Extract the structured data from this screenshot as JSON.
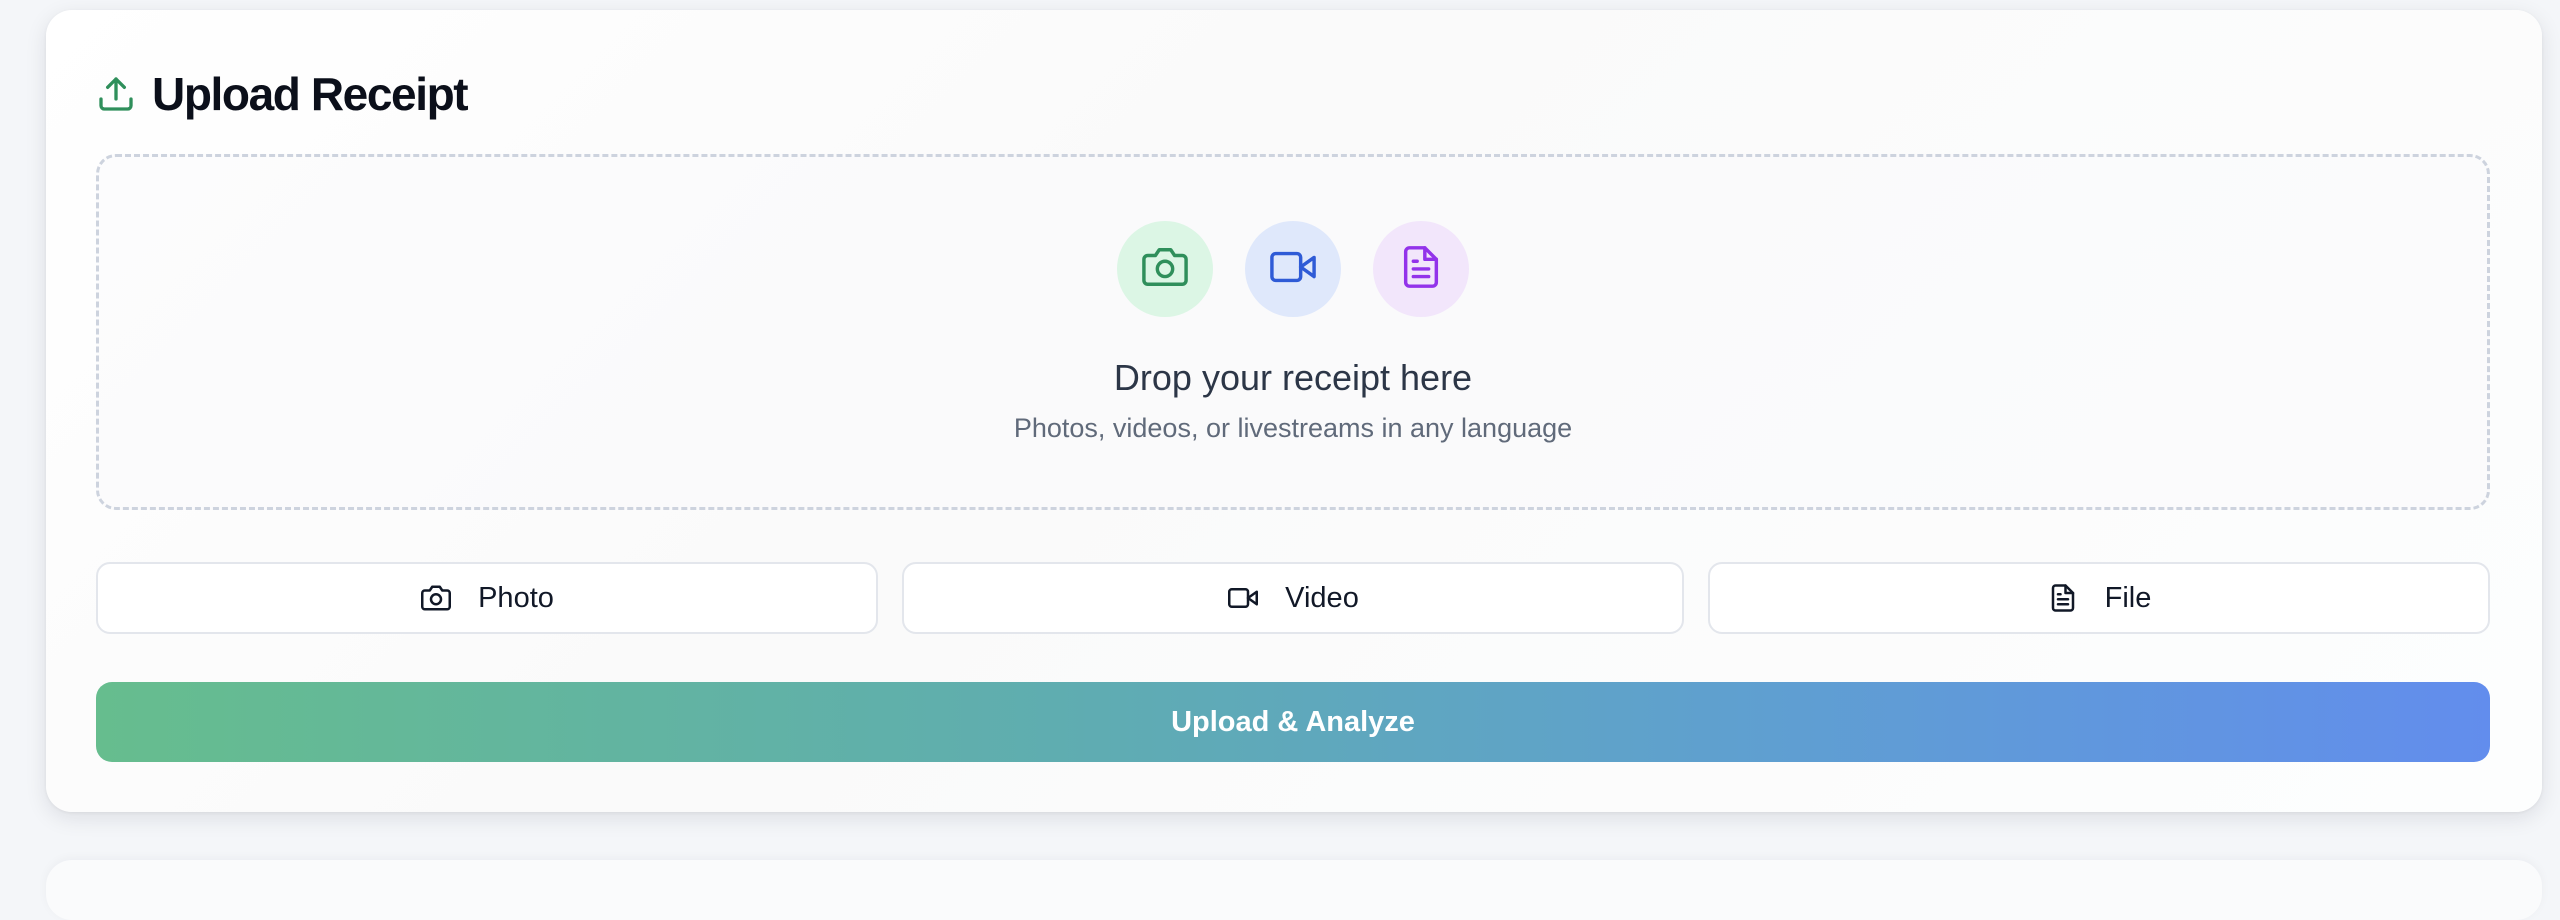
{
  "header": {
    "title": "Upload Receipt",
    "icon": "upload-icon",
    "icon_color": "#2f8f5b"
  },
  "dropzone": {
    "icons": [
      {
        "name": "camera-icon",
        "color": "#2f8f5b",
        "bg": "#dcf6e5"
      },
      {
        "name": "video-icon",
        "color": "#2f5bd6",
        "bg": "#dfe8fb"
      },
      {
        "name": "document-icon",
        "color": "#9333ea",
        "bg": "#f2e6fb"
      }
    ],
    "title": "Drop your receipt here",
    "subtitle": "Photos, videos, or livestreams in any language"
  },
  "options": [
    {
      "label": "Photo",
      "icon": "camera-icon"
    },
    {
      "label": "Video",
      "icon": "video-icon"
    },
    {
      "label": "File",
      "icon": "document-icon"
    }
  ],
  "primary_button": {
    "label": "Upload & Analyze",
    "gradient_start": "#66bd8e",
    "gradient_end": "#628ded"
  }
}
